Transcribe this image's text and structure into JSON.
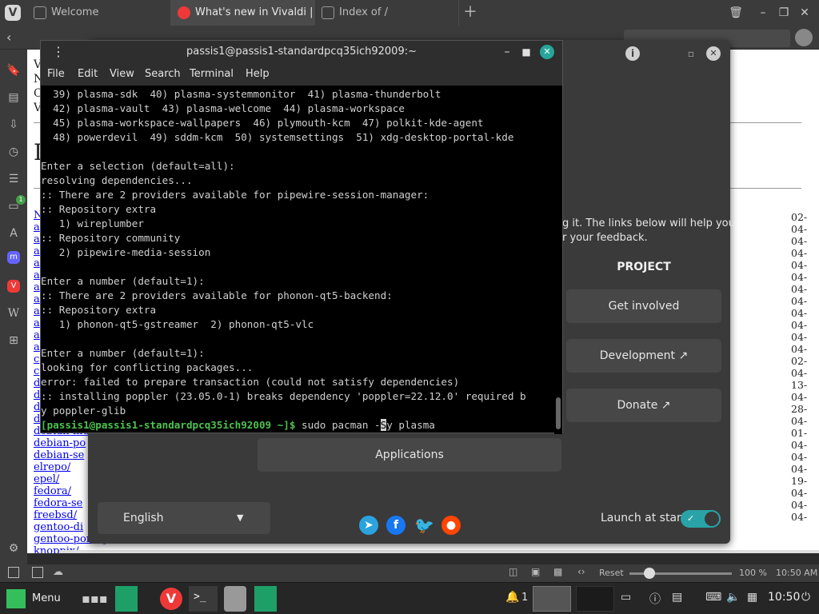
{
  "browser": {
    "tabs": [
      {
        "title": "Welcome"
      },
      {
        "title": "What's new in Vivaldi | Vivaldi"
      },
      {
        "title": "Index of /"
      }
    ],
    "brand_color": "#ef3939",
    "status": {
      "reset_label": "Reset",
      "zoom": "100 %",
      "time": "10:50 AM"
    }
  },
  "page": {
    "top_letters": [
      "V",
      "N",
      "C",
      "V"
    ],
    "heading_letter": "I",
    "left_links": [
      "N",
      "a",
      "a",
      "a",
      "a",
      "a",
      "a",
      "a",
      "a",
      "a",
      "a",
      "a",
      "c",
      "c",
      "d",
      "d",
      "d",
      "d",
      "debian-mu",
      "debian-po",
      "debian-se",
      "elrepo/",
      "epel/",
      "fedora/",
      "fedora-se",
      "freebsd/",
      "gentoo-di",
      "gentoo-portage/",
      "knoppix/"
    ],
    "dates": [
      "02-",
      "04-",
      "04-",
      "04-",
      "04-",
      "04-",
      "04-",
      "04-",
      "04-",
      "04-",
      "04-",
      "04-",
      "02-",
      "04-",
      "13-",
      "04-",
      "28-",
      "04-",
      "01-",
      "04-",
      "04-",
      "04-",
      "19-",
      "04-",
      "04-",
      "04-"
    ]
  },
  "welcome": {
    "text_line1": "g it. The links below will help you",
    "text_line2": "r your feedback.",
    "section_title": "PROJECT",
    "buttons": [
      {
        "label": "Get involved"
      },
      {
        "label": "Development ↗"
      },
      {
        "label": "Donate ↗"
      }
    ],
    "applications_label": "Applications",
    "language": "English",
    "launch_at_start": "Launch at start",
    "toggle_on": true,
    "social": [
      "telegram-icon",
      "facebook-icon",
      "twitter-icon",
      "reddit-icon"
    ]
  },
  "terminal": {
    "title": "passis1@passis1-standardpcq35ich92009:~",
    "menu": [
      "File",
      "Edit",
      "View",
      "Search",
      "Terminal",
      "Help"
    ],
    "lines": [
      "  39) plasma-sdk  40) plasma-systemmonitor  41) plasma-thunderbolt",
      "  42) plasma-vault  43) plasma-welcome  44) plasma-workspace",
      "  45) plasma-workspace-wallpapers  46) plymouth-kcm  47) polkit-kde-agent",
      "  48) powerdevil  49) sddm-kcm  50) systemsettings  51) xdg-desktop-portal-kde",
      "",
      "Enter a selection (default=all):",
      "resolving dependencies...",
      ":: There are 2 providers available for pipewire-session-manager:",
      ":: Repository extra",
      "   1) wireplumber",
      ":: Repository community",
      "   2) pipewire-media-session",
      "",
      "Enter a number (default=1):",
      ":: There are 2 providers available for phonon-qt5-backend:",
      ":: Repository extra",
      "   1) phonon-qt5-gstreamer  2) phonon-qt5-vlc",
      "",
      "Enter a number (default=1):",
      "looking for conflicting packages...",
      "error: failed to prepare transaction (could not satisfy dependencies)",
      ":: installing poppler (23.05.0-1) breaks dependency 'poppler=22.12.0' required b",
      "y poppler-glib"
    ],
    "prompt": "[passis1@passis1-standardpcq35ich92009 ~]$",
    "command_before": " sudo pacman -",
    "command_cursor": "S",
    "command_after": "y plasma"
  },
  "taskbar": {
    "menu_label": "Menu",
    "notifications": "1",
    "clock": "10:50"
  }
}
